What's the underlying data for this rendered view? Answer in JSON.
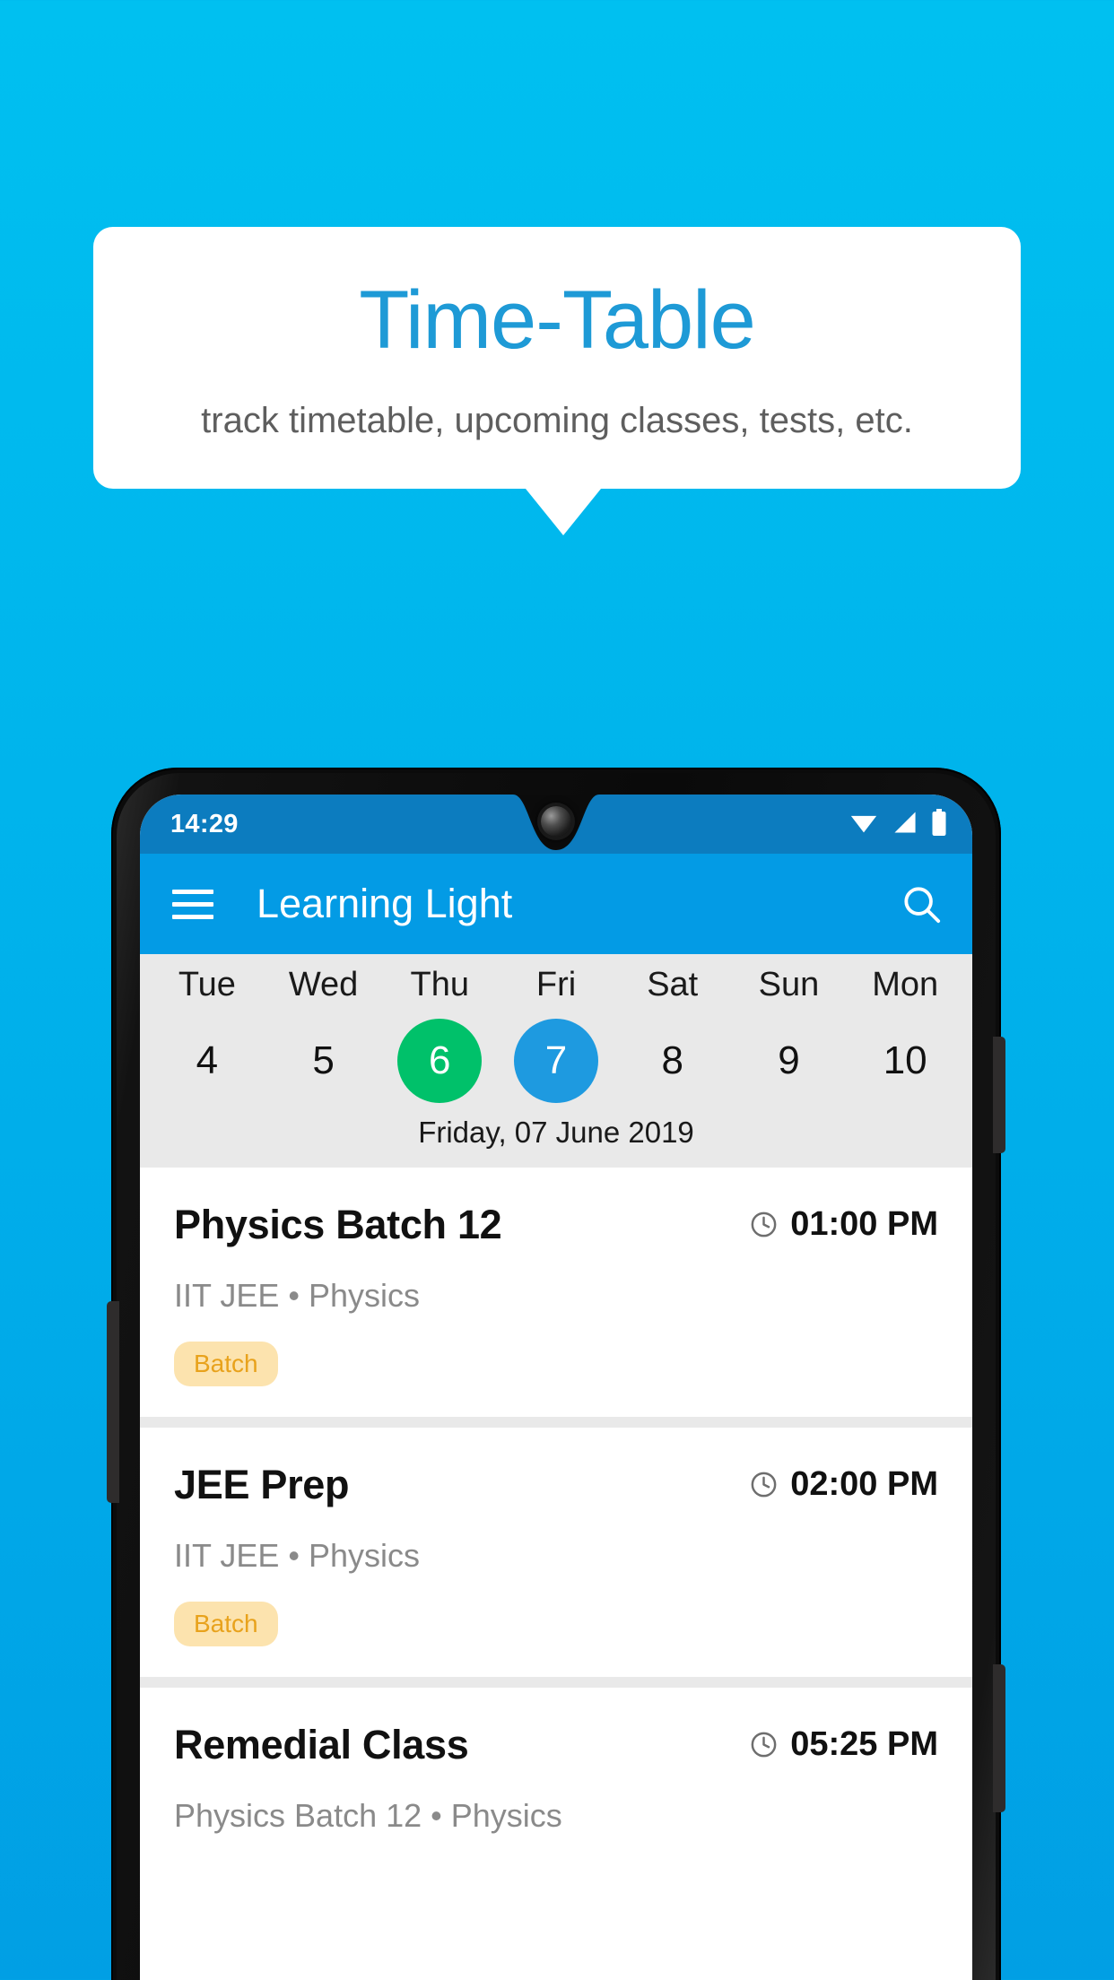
{
  "promo": {
    "title": "Time-Table",
    "subtitle": "track timetable, upcoming classes, tests, etc."
  },
  "colors": {
    "background_top": "#00C0F0",
    "background_bottom": "#019FE4",
    "promo_title": "#1E9AD6",
    "appbar": "#039BE5",
    "statusbar": "#0C7CBF",
    "today_circle": "#00C16A",
    "selected_circle": "#1E9AE0",
    "tag_bg": "#FCE3AE",
    "tag_text": "#E8A21C"
  },
  "phone": {
    "statusbar": {
      "time": "14:29",
      "icons": [
        "wifi-icon",
        "signal-icon",
        "battery-icon"
      ]
    },
    "appbar": {
      "menu_icon": "hamburger-menu-icon",
      "title": "Learning Light",
      "search_icon": "search-icon"
    },
    "calendar": {
      "days": [
        {
          "name": "Tue",
          "num": "4",
          "state": "normal"
        },
        {
          "name": "Wed",
          "num": "5",
          "state": "normal"
        },
        {
          "name": "Thu",
          "num": "6",
          "state": "today"
        },
        {
          "name": "Fri",
          "num": "7",
          "state": "selected"
        },
        {
          "name": "Sat",
          "num": "8",
          "state": "normal"
        },
        {
          "name": "Sun",
          "num": "9",
          "state": "normal"
        },
        {
          "name": "Mon",
          "num": "10",
          "state": "normal"
        }
      ],
      "selected_date_label": "Friday, 07 June 2019"
    },
    "schedule": [
      {
        "title": "Physics Batch 12",
        "time": "01:00 PM",
        "subtitle": "IIT JEE • Physics",
        "tag": "Batch"
      },
      {
        "title": "JEE Prep",
        "time": "02:00 PM",
        "subtitle": "IIT JEE • Physics",
        "tag": "Batch"
      },
      {
        "title": "Remedial Class",
        "time": "05:25 PM",
        "subtitle": "Physics Batch 12 • Physics",
        "tag": ""
      }
    ]
  }
}
